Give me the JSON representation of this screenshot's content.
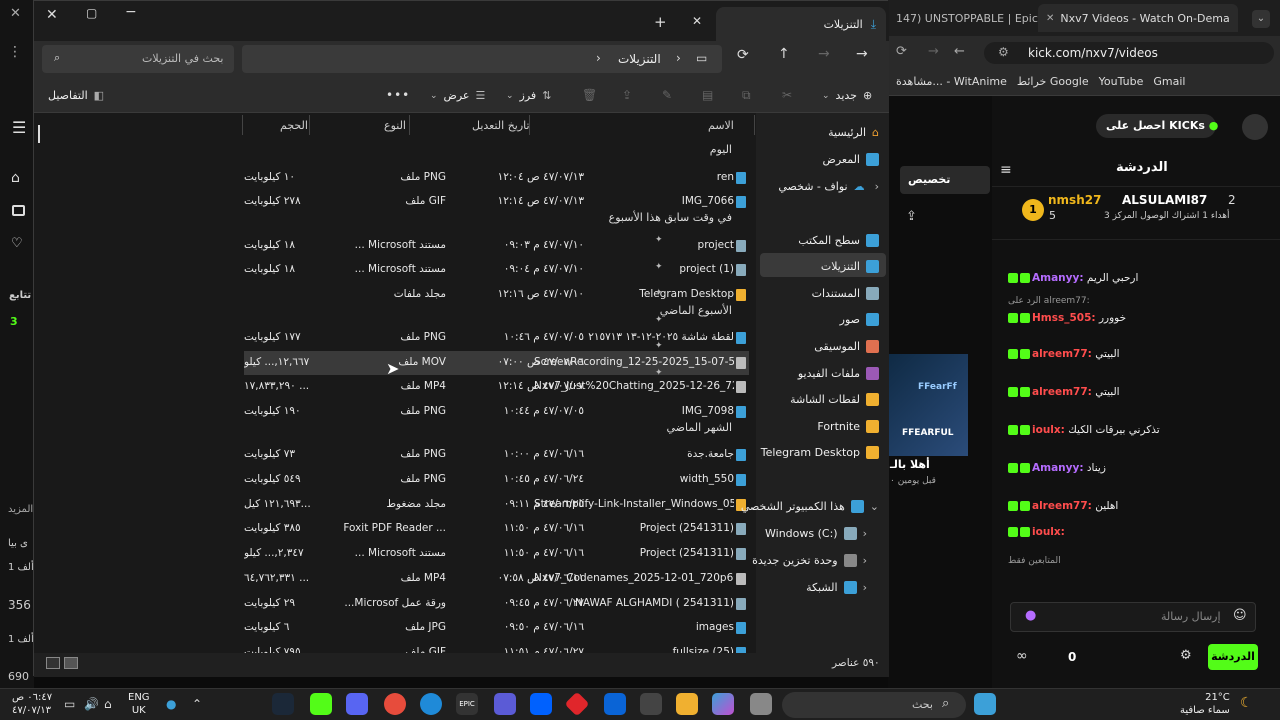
{
  "browser": {
    "tabs": [
      {
        "label": "147) UNSTOPPABLE | Epic Sor"
      },
      {
        "label": "Nxv7 Videos - Watch On-Dema"
      }
    ],
    "url": "kick.com/nxv7/videos",
    "bookmarks": [
      "Gmail",
      "YouTube",
      "خرائط Google",
      "مشاهدة... - WitAnime"
    ]
  },
  "explorer": {
    "tab_title": "التنزيلات",
    "breadcrumb": "التنزيلات",
    "search_placeholder": "بحث في التنزيلات",
    "toolbar": {
      "new": "جديد",
      "sort": "فرز",
      "view": "عرض",
      "more": "•••",
      "details": "التفاصيل"
    },
    "columns": {
      "name": "الاسم",
      "date": "تاريخ التعديل",
      "type": "النوع",
      "size": "الحجم"
    },
    "sidebar": {
      "home": "الرئيسية",
      "gallery": "المعرض",
      "onedrive": "نواف - شخصي",
      "pinned": [
        "سطح المكتب",
        "التنزيلات",
        "المستندات",
        "صور",
        "الموسيقى",
        "ملفات الفيديو",
        "لقطات الشاشة",
        "Fortnite",
        "Telegram Desktop"
      ],
      "this_pc": "هذا الكمبيوتر الشخصي",
      "drives": [
        "Windows (C:)",
        "وحدة تخزين جديدة",
        "الشبكة"
      ]
    },
    "groups": {
      "today": "اليوم",
      "earlier_week": "في وقت سابق هذا الأسبوع",
      "last_week": "الأسبوع الماضي",
      "last_month": "الشهر الماضي"
    },
    "files": [
      {
        "name": "ren",
        "date": "٤٧/٠٧/١٣ ص ١٢:٠٤",
        "type": "ملف PNG",
        "size": "١٠ كيلوبايت"
      },
      {
        "name": "IMG_7066",
        "date": "٤٧/٠٧/١٣ ص ١٢:١٤",
        "type": "ملف GIF",
        "size": "٢٧٨ كيلوبايت"
      },
      {
        "name": "project",
        "date": "٤٧/٠٧/١٠ م ٠٩:٠٣",
        "type": "... Microsoft مستند",
        "size": "١٨ كيلوبايت"
      },
      {
        "name": "project (1)",
        "date": "٤٧/٠٧/١٠ م ٠٩:٠٤",
        "type": "... Microsoft مستند",
        "size": "١٨ كيلوبايت"
      },
      {
        "name": "Telegram Desktop",
        "date": "٤٧/٠٧/١٠ ص ١٢:١٦",
        "type": "مجلد ملفات",
        "size": ""
      },
      {
        "name": "لقطة شاشة ٢٠٢٥-١٢-١٣ ٢١٥٧١٣",
        "date": "٤٧/٠٧/٠٥ م ١٠:٤٦",
        "type": "ملف PNG",
        "size": "١٧٧ كيلوبايت"
      },
      {
        "name": "ScreenRecording_12-25-2025_15-07-55_1",
        "date": "٤٧/٠٧/٠٦ ص ٠٧:٠٠",
        "type": "ملف MOV",
        "size": "١٢,٦٦٧,... كيلو"
      },
      {
        "name": "Nxv7_Just%20Chatting_2025-12-26_720p...",
        "date": "٤٧/٠٧/٠٧ ص ١٢:١٤",
        "type": "ملف MP4",
        "size": "١٧,٨٣٣,٢٩٠ ..."
      },
      {
        "name": "IMG_7098",
        "date": "٤٧/٠٧/٠٥ م ١٠:٤٤",
        "type": "ملف PNG",
        "size": "١٩٠ كيلوبايت"
      },
      {
        "name": "جامعة.جدة",
        "date": "٤٧/٠٦/١٦ م ١٠:٠٠",
        "type": "ملف PNG",
        "size": "٧٣ كيلوبايت"
      },
      {
        "name": "width_550",
        "date": "٤٧/٠٦/٢٤ م ١٠:٤٥",
        "type": "ملف PNG",
        "size": "٥٤٩ كيلوبايت"
      },
      {
        "name": "Streamplify-Link-Installer_Windows_0526...",
        "date": "٤٧/٠٦/٢٥ م ٠٩:١١",
        "type": "مجلد مضغوط",
        "size": "١٢١,٦٩٣ كيل..."
      },
      {
        "name": "Project (2541311)",
        "date": "٤٧/٠٦/١٦ م ١١:٥٠",
        "type": "Foxit PDF Reader ...",
        "size": "٣٨٥ كيلوبايت"
      },
      {
        "name": "Project (2541311)",
        "date": "٤٧/٠٦/١٦ م ١١:٥٠",
        "type": "... Microsoft مستند",
        "size": "٢,٣٤٧,... كيلو"
      },
      {
        "name": "Nxv7_Codenames_2025-12-01_720p60",
        "date": "٤٧/٠٦/١١ ص ٠٧:٥٨",
        "type": "ملف MP4",
        "size": "٦٤,٧٦٢,٣٣١ ..."
      },
      {
        "name": "NAWAF ALGHAMDI ( 2541311)",
        "date": "٤٧/٠٦/٢٧ م ٠٩:٤٥",
        "type": "...Microsof ورقة عمل",
        "size": "٢٩ كيلوبايت"
      },
      {
        "name": "images",
        "date": "٤٧/٠٦/١٦ م ٠٩:٥٠",
        "type": "ملف JPG",
        "size": "٦ كيلوبايت"
      },
      {
        "name": "fullsize (25)",
        "date": "٤٧/٠٦/٢٧ م ١١:٥١",
        "type": "ملف GIF",
        "size": "٧٩٥ كيلوبايت"
      }
    ],
    "status": "٥٩٠ عناصر"
  },
  "kick": {
    "get_kicks": "احصل على KICKs",
    "chat_title": "الدردشة",
    "customize": "تخصيص",
    "leaders": [
      {
        "name": "nmsh27",
        "count": "2"
      },
      {
        "name": "ALSULAMI87",
        "count": "5"
      }
    ],
    "gift_note": "أهداء 1 اشتراك الوصول المركز 3",
    "messages": [
      {
        "user": "",
        "text": "ارحبي الريم"
      },
      {
        "user": "Amanyy:",
        "text": "ارحبي الريم"
      },
      {
        "user": "Hmss_505:",
        "text": "خوورر"
      },
      {
        "user": "alreem77:",
        "text": "البيتي"
      },
      {
        "user": "alreem77:",
        "text": "البيتي"
      },
      {
        "user": "ioulx:",
        "text": "تذكرني بيرقات الكيك"
      },
      {
        "user": "Amanyy:",
        "text": "زيناد"
      },
      {
        "user": "alreem77:",
        "text": "اهلين"
      },
      {
        "user": "ioulx:",
        "text": ""
      }
    ],
    "followers_only": "المتابعين فقط",
    "send_placeholder": "إرسال رسالة",
    "chat_button": "الدردشة",
    "viewer_count": "0",
    "left_labels": [
      "تتابع",
      "3",
      "المزيد",
      "ى بيا",
      "1 ألف",
      "356",
      "1 ألف",
      "690"
    ],
    "video_title": "أهلا بالـ",
    "video_sub": "قبل يومين ٠"
  },
  "taskbar": {
    "weather_temp": "21°C",
    "weather_desc": "سماء صافية",
    "search": "بحث",
    "lang": "ENG",
    "region": "UK",
    "time": "٠٦:٤٧ ص",
    "date": "٤٧/٠٧/١٣"
  }
}
